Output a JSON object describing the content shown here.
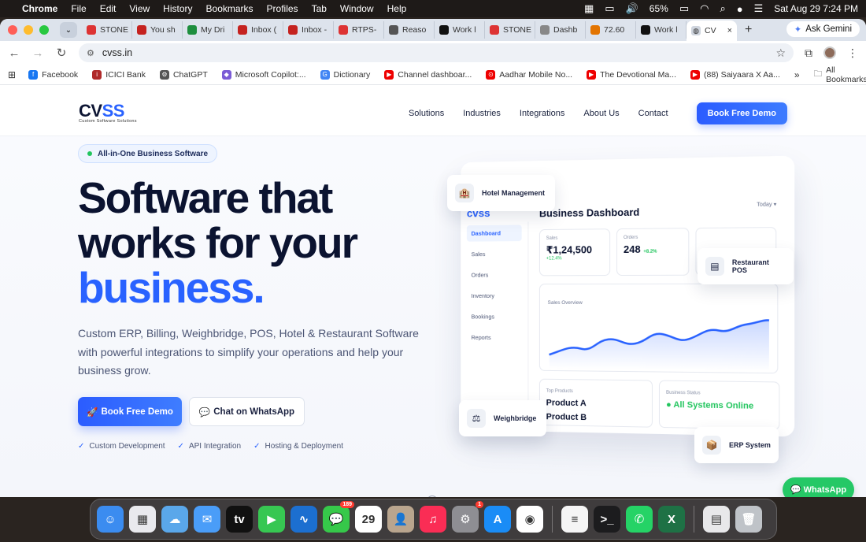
{
  "menubar": {
    "app": "Chrome",
    "items": [
      "File",
      "Edit",
      "View",
      "History",
      "Bookmarks",
      "Profiles",
      "Tab",
      "Window",
      "Help"
    ],
    "battery": "65%",
    "datetime": "Sat Aug 29  7:24 PM"
  },
  "tabs": [
    {
      "label": "STONE",
      "color": "#d33"
    },
    {
      "label": "You sh",
      "color": "#c5221f"
    },
    {
      "label": "My Dri",
      "color": "#1e8e3e"
    },
    {
      "label": "Inbox (",
      "color": "#c5221f"
    },
    {
      "label": "Inbox -",
      "color": "#c5221f"
    },
    {
      "label": "RTPS-",
      "color": "#d33"
    },
    {
      "label": "Reaso",
      "color": "#555"
    },
    {
      "label": "Work l",
      "color": "#111"
    },
    {
      "label": "STONE",
      "color": "#d33"
    },
    {
      "label": "Dashb",
      "color": "#888"
    },
    {
      "label": "72.60",
      "color": "#e37400"
    },
    {
      "label": "Work l",
      "color": "#111"
    }
  ],
  "active_tab": {
    "label": "CV",
    "close": "×"
  },
  "gemini_label": "Ask Gemini",
  "url": "cvss.in",
  "bookmarks": [
    {
      "label": "Facebook",
      "color": "#1877f2",
      "glyph": "f"
    },
    {
      "label": "ICICI Bank",
      "color": "#b02a2a",
      "glyph": "i"
    },
    {
      "label": "ChatGPT",
      "color": "#555",
      "glyph": "⚙"
    },
    {
      "label": "Microsoft Copilot:...",
      "color": "#7b5cd6",
      "glyph": "◆"
    },
    {
      "label": "Dictionary",
      "color": "#4285f4",
      "glyph": "G"
    },
    {
      "label": "Channel dashboar...",
      "color": "#e00",
      "glyph": "▶"
    },
    {
      "label": "Aadhar Mobile No...",
      "color": "#e00",
      "glyph": "⊙"
    },
    {
      "label": "The Devotional Ma...",
      "color": "#e00",
      "glyph": "▶"
    },
    {
      "label": "(88) Saiyaara X Aa...",
      "color": "#e00",
      "glyph": "▶"
    }
  ],
  "all_bookmarks": "All Bookmarks",
  "site": {
    "logo_main": "CV",
    "logo_accent": "SS",
    "logo_tagline": "Custom Software Solutions",
    "nav": [
      "Solutions",
      "Industries",
      "Integrations",
      "About Us",
      "Contact"
    ],
    "nav_cta": "Book Free Demo",
    "badge": "All-in-One Business Software",
    "headline_1": "Software that",
    "headline_2": "works for your",
    "headline_3": "business.",
    "subtext": "Custom ERP, Billing, Weighbridge, POS, Hotel & Restaurant Software with powerful integrations to simplify your operations and help your business grow.",
    "primary_btn": "Book Free Demo",
    "secondary_btn": "Chat on WhatsApp",
    "features": [
      "Custom Development",
      "API Integration",
      "Hosting & Deployment"
    ],
    "whatsapp_btn": "WhatsApp"
  },
  "dashboard": {
    "logo": "cvss",
    "title": "Business Dashboard",
    "range": "Today ▾",
    "menu": [
      "Dashboard",
      "Sales",
      "Orders",
      "Inventory",
      "Bookings",
      "Reports"
    ],
    "kpis": [
      {
        "label": "Sales",
        "value": "₹1,24,500",
        "change": "+12.4%"
      },
      {
        "label": "Orders",
        "value": "248",
        "change": "+8.2%"
      }
    ],
    "sales_overview": "Sales Overview",
    "top_products_label": "Top Products",
    "top_products": [
      "Product A",
      "Product B"
    ],
    "status_label": "Business Status",
    "status_value": "● All Systems Online",
    "floats": [
      "Hotel Management",
      "Restaurant POS",
      "Weighbridge",
      "ERP System"
    ]
  },
  "dock": {
    "apps": [
      {
        "name": "finder",
        "color": "#3b8cf0",
        "glyph": "☺"
      },
      {
        "name": "launchpad",
        "color": "#e9e9ee",
        "glyph": "▦"
      },
      {
        "name": "weather",
        "color": "#5aa7ea",
        "glyph": "☁"
      },
      {
        "name": "mail",
        "color": "#4a9df8",
        "glyph": "✉"
      },
      {
        "name": "apple-tv",
        "color": "#111",
        "glyph": "tv"
      },
      {
        "name": "facetime",
        "color": "#37c752",
        "glyph": "▶"
      },
      {
        "name": "freeform",
        "color": "#1c6fd0",
        "glyph": "∿"
      },
      {
        "name": "messages",
        "color": "#36c84a",
        "glyph": "💬",
        "badge": "189"
      },
      {
        "name": "calendar",
        "color": "#fff",
        "glyph": "29"
      },
      {
        "name": "contacts",
        "color": "#b9a58e",
        "glyph": "👤"
      },
      {
        "name": "music",
        "color": "#fa2d55",
        "glyph": "♫"
      },
      {
        "name": "system-settings",
        "color": "#8e8e93",
        "glyph": "⚙",
        "badge": "1"
      },
      {
        "name": "app-store",
        "color": "#1a8cf6",
        "glyph": "A"
      },
      {
        "name": "chrome",
        "color": "#fff",
        "glyph": "◉"
      }
    ],
    "recent": [
      {
        "name": "textedit",
        "color": "#f5f5f5",
        "glyph": "≡"
      },
      {
        "name": "terminal",
        "color": "#1c1c1e",
        "glyph": ">_"
      },
      {
        "name": "whatsapp",
        "color": "#25d366",
        "glyph": "✆"
      },
      {
        "name": "excel",
        "color": "#1e7145",
        "glyph": "X"
      }
    ],
    "extras": [
      {
        "name": "downloads-stack",
        "color": "#e8e8ea",
        "glyph": "▤"
      },
      {
        "name": "trash",
        "color": "#bfc3c8",
        "glyph": "🗑"
      }
    ]
  }
}
